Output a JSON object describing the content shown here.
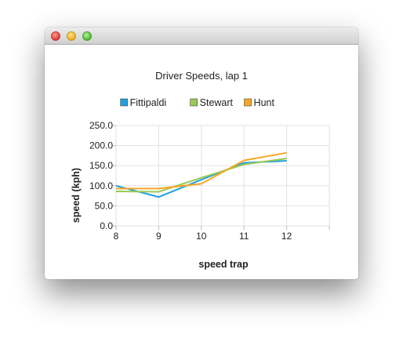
{
  "window": {
    "title": ""
  },
  "chart_data": {
    "type": "line",
    "title": "Driver Speeds, lap 1",
    "xlabel": "speed trap",
    "ylabel": "speed (kph)",
    "x": [
      8,
      9,
      10,
      11,
      12
    ],
    "xlim": [
      8,
      13
    ],
    "ylim": [
      0,
      250
    ],
    "x_ticks": [
      "8",
      "9",
      "10",
      "11",
      "12"
    ],
    "y_ticks": [
      "0.0",
      "50.0",
      "100.0",
      "150.0",
      "200.0",
      "250.0"
    ],
    "grid": true,
    "legend_position": "top",
    "series": [
      {
        "name": "Fittipaldi",
        "color": "#209fdf",
        "values": [
          100,
          72,
          115,
          157,
          162
        ]
      },
      {
        "name": "Stewart",
        "color": "#99ca53",
        "values": [
          86,
          85,
          120,
          153,
          168
        ]
      },
      {
        "name": "Hunt",
        "color": "#f6a625",
        "values": [
          93,
          93,
          105,
          163,
          182
        ]
      }
    ]
  }
}
